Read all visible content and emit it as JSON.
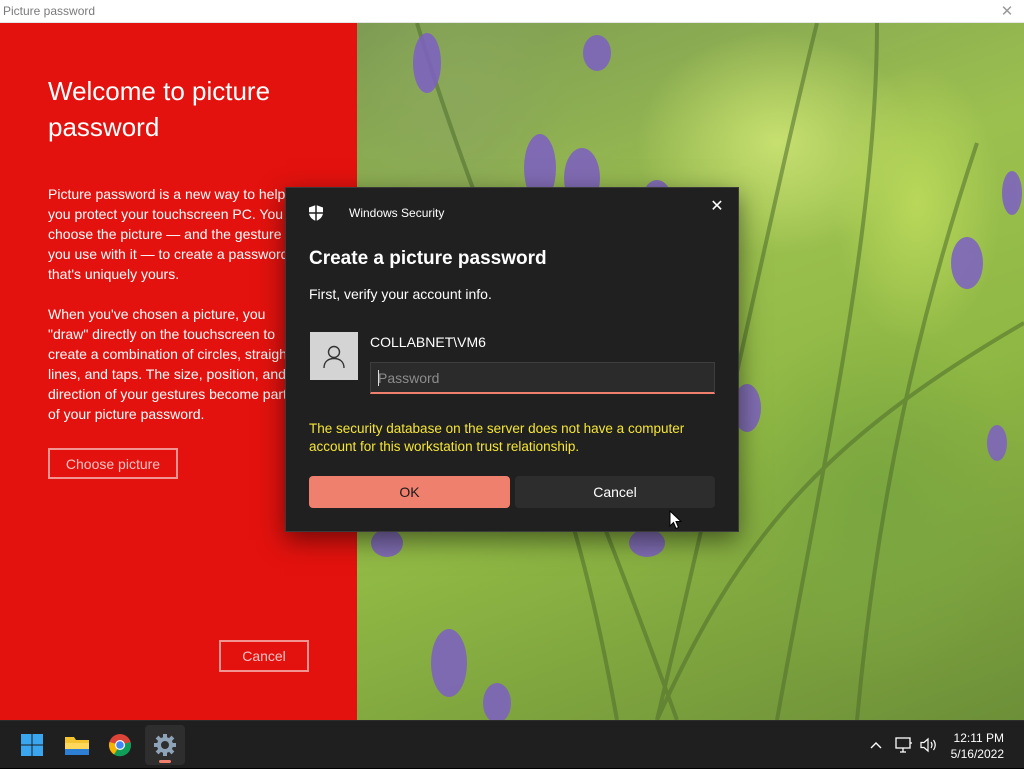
{
  "window": {
    "title": "Picture password"
  },
  "left": {
    "heading": "Welcome to picture password",
    "para1": "Picture password is a new way to help\nyou protect your touchscreen PC. You\nchoose the picture — and the gesture\nyou use with it — to create a password\nthat's uniquely yours.",
    "para2": "When you've chosen a picture, you\n\"draw\" directly on the touchscreen to\ncreate a combination of circles, straight\nlines, and taps. The size, position, and\ndirection of your gestures become part\nof your picture password.",
    "choose_label": "Choose picture",
    "cancel_label": "Cancel"
  },
  "dialog": {
    "app_name": "Windows Security",
    "heading": "Create a picture password",
    "subtitle": "First, verify your account info.",
    "username": "COLLABNET\\VM6",
    "password_placeholder": "Password",
    "error": "The security database on the server does not have a computer account for this workstation trust relationship.",
    "ok_label": "OK",
    "cancel_label": "Cancel"
  },
  "taskbar": {
    "apps": [
      "windows-start-icon",
      "file-explorer-icon",
      "chrome-icon",
      "settings-icon"
    ],
    "clock_time": "12:11 PM",
    "clock_date": "5/16/2022"
  },
  "colors": {
    "accent_red": "#e3120e",
    "dialog_bg": "#202020",
    "ok_button": "#f0806e",
    "error_text": "#f5e634"
  }
}
